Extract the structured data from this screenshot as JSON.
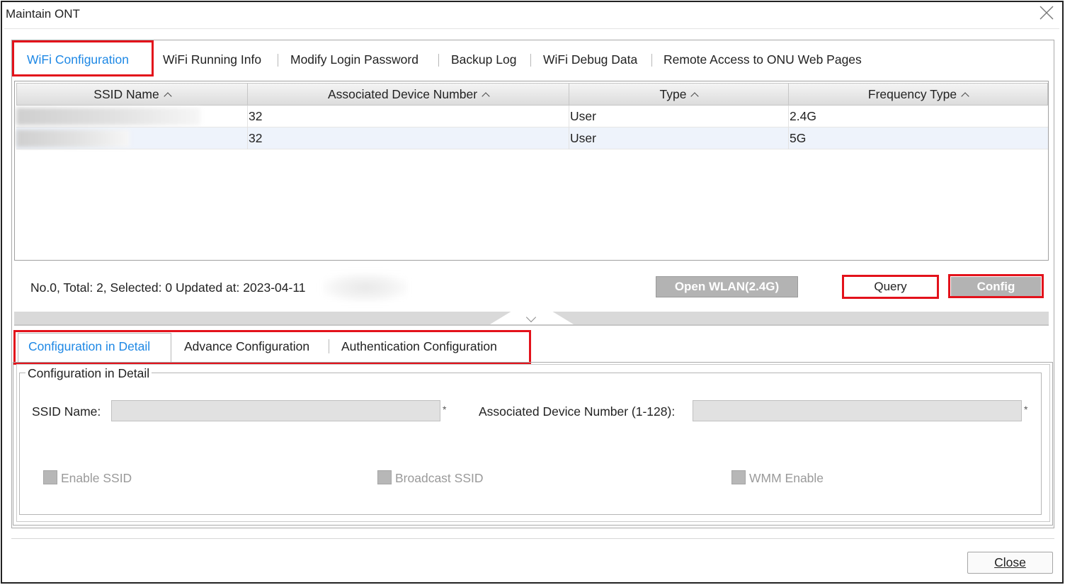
{
  "window": {
    "title": "Maintain ONT"
  },
  "tabs": [
    {
      "label": "WiFi Configuration",
      "active": true
    },
    {
      "label": "WiFi Running Info",
      "active": false
    },
    {
      "label": "Modify Login Password",
      "active": false
    },
    {
      "label": "Backup Log",
      "active": false
    },
    {
      "label": "WiFi Debug Data",
      "active": false
    },
    {
      "label": "Remote Access to ONU Web Pages",
      "active": false
    }
  ],
  "table": {
    "columns": [
      "SSID Name",
      "Associated Device Number",
      "Type",
      "Frequency Type"
    ],
    "rows": [
      {
        "ssid": "",
        "associated": "32",
        "type": "User",
        "frequency": "2.4G"
      },
      {
        "ssid": "",
        "associated": "32",
        "type": "User",
        "frequency": "5G"
      }
    ]
  },
  "status": {
    "text": "No.0, Total: 2, Selected: 0   Updated at: 2023-04-11"
  },
  "buttons": {
    "open_wlan": "Open WLAN(2.4G)",
    "query": "Query",
    "config": "Config",
    "close": "Close"
  },
  "detail_tabs": [
    {
      "label": "Configuration in Detail",
      "active": true
    },
    {
      "label": "Advance Configuration",
      "active": false
    },
    {
      "label": "Authentication Configuration",
      "active": false
    }
  ],
  "detail": {
    "legend": "Configuration in Detail",
    "ssid_label": "SSID Name:",
    "ssid_value": "",
    "assoc_label": "Associated Device Number (1-128):",
    "assoc_value": "",
    "required_mark": "*",
    "checkboxes": [
      {
        "label": "Enable SSID",
        "checked": false
      },
      {
        "label": "Broadcast SSID",
        "checked": false
      },
      {
        "label": "WMM Enable",
        "checked": false
      }
    ]
  },
  "colors": {
    "accent": "#1e88e5",
    "highlight": "#e3121b",
    "button_gray": "#b3b3b3"
  }
}
